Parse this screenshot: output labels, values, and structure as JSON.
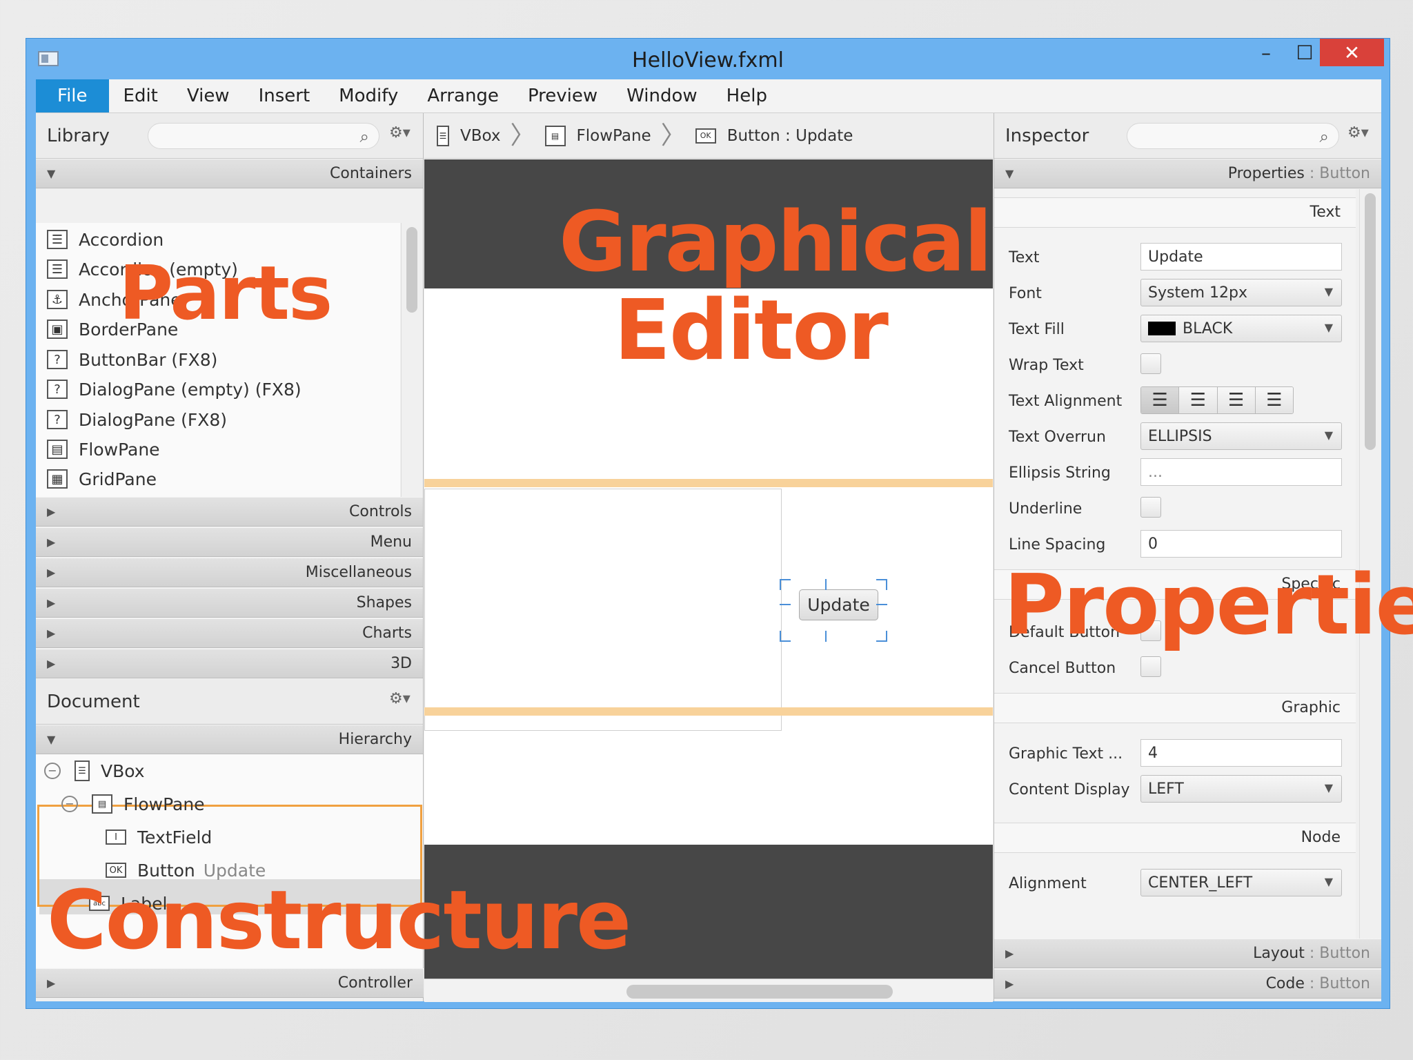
{
  "window": {
    "title": "HelloView.fxml"
  },
  "menu": [
    "File",
    "Edit",
    "View",
    "Insert",
    "Modify",
    "Arrange",
    "Preview",
    "Window",
    "Help"
  ],
  "library": {
    "title": "Library",
    "section_open": "Containers",
    "items": [
      "Accordion",
      "Accordion  (empty)",
      "AnchorPane",
      "BorderPane",
      "ButtonBar  (FX8)",
      "DialogPane (empty)  (FX8)",
      "DialogPane  (FX8)",
      "FlowPane",
      "GridPane"
    ],
    "sections": [
      "Controls",
      "Menu",
      "Miscellaneous",
      "Shapes",
      "Charts",
      "3D"
    ]
  },
  "document": {
    "title": "Document",
    "section": "Hierarchy",
    "tree": [
      {
        "label": "VBox",
        "extra": ""
      },
      {
        "label": "FlowPane",
        "extra": ""
      },
      {
        "label": "TextField",
        "extra": ""
      },
      {
        "label": "Button",
        "extra": "Update"
      },
      {
        "label": "Label",
        "extra": ""
      }
    ],
    "footer": "Controller"
  },
  "breadcrumb": [
    "VBox",
    "FlowPane",
    "Button : Update"
  ],
  "editor": {
    "button_label": "Update"
  },
  "inspector": {
    "title": "Inspector",
    "section": "Properties",
    "section_target": "Button",
    "groups": [
      "Text",
      "Specific",
      "Graphic",
      "Node"
    ],
    "rows": {
      "text": {
        "label": "Text",
        "value": "Update"
      },
      "font": {
        "label": "Font",
        "value": "System 12px"
      },
      "text_fill": {
        "label": "Text Fill",
        "value": "BLACK"
      },
      "wrap_text": {
        "label": "Wrap Text"
      },
      "text_alignment": {
        "label": "Text Alignment"
      },
      "text_overrun": {
        "label": "Text Overrun",
        "value": "ELLIPSIS"
      },
      "ellipsis_string": {
        "label": "Ellipsis String",
        "value": "..."
      },
      "underline": {
        "label": "Underline"
      },
      "line_spacing": {
        "label": "Line Spacing",
        "value": "0"
      },
      "default_button": {
        "label": "Default Button"
      },
      "cancel_button": {
        "label": "Cancel Button"
      },
      "graphic_text_gap": {
        "label": "Graphic Text ...",
        "value": "4"
      },
      "content_display": {
        "label": "Content Display",
        "value": "LEFT"
      },
      "alignment": {
        "label": "Alignment",
        "value": "CENTER_LEFT"
      }
    },
    "bottom_sections": [
      {
        "label": "Layout",
        "target": "Button"
      },
      {
        "label": "Code",
        "target": "Button"
      }
    ]
  },
  "overlays": {
    "parts": "Parts",
    "graphical": "Graphical",
    "editor": "Editor",
    "properties": "Properties",
    "constructure": "Constructure"
  },
  "colors": {
    "accent": "#1c8dd6",
    "overlay": "#ee5a24",
    "selection": "#f0a040"
  }
}
